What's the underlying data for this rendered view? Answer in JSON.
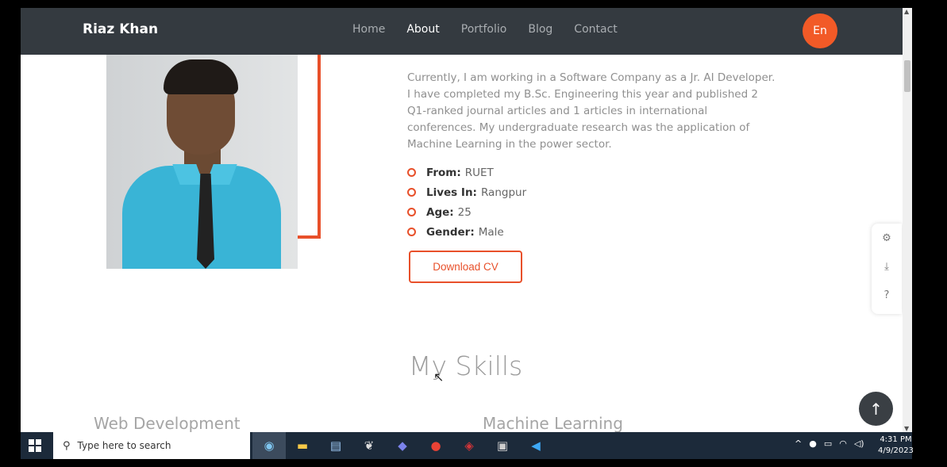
{
  "nav": {
    "brand": "Riaz Khan",
    "items": [
      {
        "label": "Home",
        "active": false
      },
      {
        "label": "About",
        "active": true
      },
      {
        "label": "Portfolio",
        "active": false
      },
      {
        "label": "Blog",
        "active": false
      },
      {
        "label": "Contact",
        "active": false
      }
    ],
    "language": "En"
  },
  "about": {
    "bio": "Currently, I am working in a Software Company as a Jr. AI Developer. I have completed my B.Sc. Engineering this year and published 2 Q1-ranked journal articles and 1 articles in international conferences. My undergraduate research was the application of Machine Learning in the power sector.",
    "info": [
      {
        "key": "From:",
        "value": "RUET"
      },
      {
        "key": "Lives In:",
        "value": "Rangpur"
      },
      {
        "key": "Age:",
        "value": "25"
      },
      {
        "key": "Gender:",
        "value": "Male"
      }
    ],
    "download_label": "Download CV"
  },
  "skills": {
    "title": "My Skills",
    "left_heading": "Web Development",
    "right_heading": "Machine Learning"
  },
  "sidepanel": {
    "icons": [
      "gear-icon",
      "download-icon",
      "help-icon"
    ]
  },
  "taskbar": {
    "search_placeholder": "Type here to search",
    "time": "4:31 PM",
    "date": "4/9/2023"
  },
  "colors": {
    "accent": "#e8502a",
    "nav_bg": "#343a40",
    "lang_button": "#f25a27"
  }
}
